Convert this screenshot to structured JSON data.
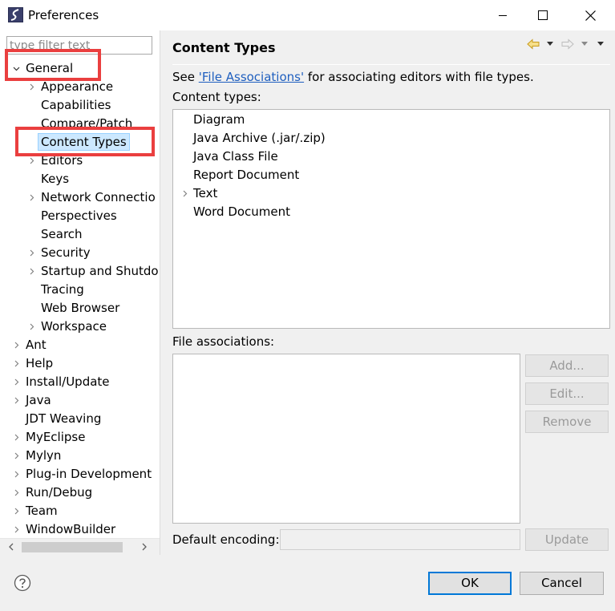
{
  "window": {
    "title": "Preferences",
    "icon": "eclipse-app-icon",
    "controls": [
      "minimize-icon",
      "maximize-icon",
      "close-icon"
    ]
  },
  "left_tree": {
    "filter_placeholder": "type filter text",
    "items": [
      {
        "label": "General",
        "level": 0,
        "expander": "expanded"
      },
      {
        "label": "Appearance",
        "level": 1,
        "expander": "collapsed"
      },
      {
        "label": "Capabilities",
        "level": 1,
        "expander": "none"
      },
      {
        "label": "Compare/Patch",
        "level": 1,
        "expander": "none"
      },
      {
        "label": "Content Types",
        "level": 1,
        "expander": "none",
        "selected": true
      },
      {
        "label": "Editors",
        "level": 1,
        "expander": "collapsed"
      },
      {
        "label": "Keys",
        "level": 1,
        "expander": "none"
      },
      {
        "label": "Network Connectio",
        "level": 1,
        "expander": "collapsed"
      },
      {
        "label": "Perspectives",
        "level": 1,
        "expander": "none"
      },
      {
        "label": "Search",
        "level": 1,
        "expander": "none"
      },
      {
        "label": "Security",
        "level": 1,
        "expander": "collapsed"
      },
      {
        "label": "Startup and Shutdo",
        "level": 1,
        "expander": "collapsed"
      },
      {
        "label": "Tracing",
        "level": 1,
        "expander": "none"
      },
      {
        "label": "Web Browser",
        "level": 1,
        "expander": "none"
      },
      {
        "label": "Workspace",
        "level": 1,
        "expander": "collapsed"
      },
      {
        "label": "Ant",
        "level": 0,
        "expander": "collapsed"
      },
      {
        "label": "Help",
        "level": 0,
        "expander": "collapsed"
      },
      {
        "label": "Install/Update",
        "level": 0,
        "expander": "collapsed"
      },
      {
        "label": "Java",
        "level": 0,
        "expander": "collapsed"
      },
      {
        "label": "JDT Weaving",
        "level": 0,
        "expander": "none"
      },
      {
        "label": "MyEclipse",
        "level": 0,
        "expander": "collapsed"
      },
      {
        "label": "Mylyn",
        "level": 0,
        "expander": "collapsed"
      },
      {
        "label": "Plug-in Development",
        "level": 0,
        "expander": "collapsed"
      },
      {
        "label": "Run/Debug",
        "level": 0,
        "expander": "collapsed"
      },
      {
        "label": "Team",
        "level": 0,
        "expander": "collapsed"
      },
      {
        "label": "WindowBuilder",
        "level": 0,
        "expander": "collapsed"
      }
    ]
  },
  "content_types_page": {
    "title": "Content Types",
    "nav_icons": [
      "back-arrow-icon",
      "back-menu-chevron-icon",
      "forward-arrow-icon",
      "forward-menu-chevron-icon",
      "view-menu-chevron-icon"
    ],
    "see_prefix": "See ",
    "see_link": "'File Associations'",
    "see_suffix": " for associating editors with file types.",
    "content_types_label": "Content types:",
    "content_types": [
      {
        "label": "Diagram",
        "expander": "none"
      },
      {
        "label": "Java Archive (.jar/.zip)",
        "expander": "none"
      },
      {
        "label": "Java Class File",
        "expander": "none"
      },
      {
        "label": "Report Document",
        "expander": "none"
      },
      {
        "label": "Text",
        "expander": "collapsed"
      },
      {
        "label": "Word Document",
        "expander": "none"
      }
    ],
    "file_associations_label": "File associations:",
    "file_associations": [],
    "add_label": "Add...",
    "edit_label": "Edit...",
    "remove_label": "Remove",
    "default_encoding_label": "Default encoding:",
    "default_encoding_value": "",
    "update_label": "Update"
  },
  "footer": {
    "help_icon": "help-question-icon",
    "ok_label": "OK",
    "cancel_label": "Cancel"
  },
  "colors": {
    "highlight_box": "#ea3f3f",
    "selection": "#cce8ff",
    "link": "#1f5fbf",
    "default_button_border": "#0078d7"
  }
}
